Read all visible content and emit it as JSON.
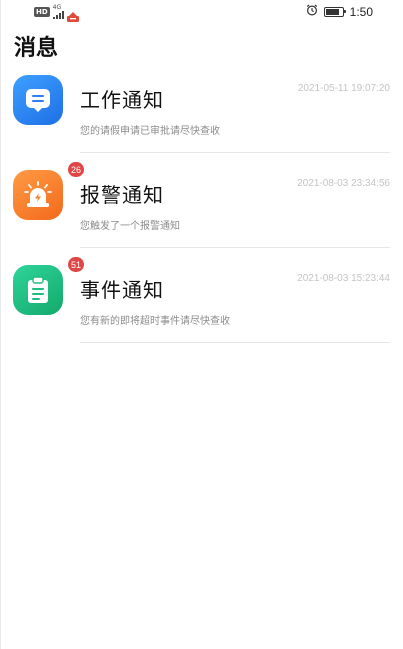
{
  "status_bar": {
    "hd": "HD",
    "network": "4G",
    "time": "1:50",
    "battery_level": 0.85
  },
  "page": {
    "title": "消息"
  },
  "notifications": [
    {
      "title": "工作通知",
      "time": "2021-05-11 19:07:20",
      "desc": "您的请假申请已审批请尽快查收",
      "badge": "",
      "icon": "message-icon",
      "color": "#2b86f2"
    },
    {
      "title": "报警通知",
      "time": "2021-08-03 23:34:56",
      "desc": "您触发了一个报警通知",
      "badge": "26",
      "icon": "alarm-icon",
      "color": "#f57f2c"
    },
    {
      "title": "事件通知",
      "time": "2021-08-03 15:23:44",
      "desc": "您有新的即将超时事件请尽快查收",
      "badge": "51",
      "icon": "clipboard-icon",
      "color": "#1dbd80"
    }
  ]
}
